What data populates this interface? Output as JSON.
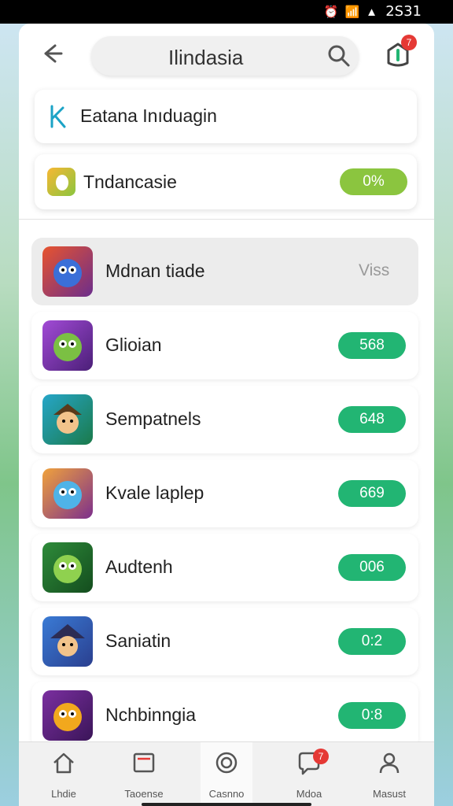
{
  "status": {
    "time": "2S31"
  },
  "header": {
    "search_text": "Ilindasia",
    "notification_badge": "7"
  },
  "cards": [
    {
      "label": "Eatana Inıduagin",
      "icon": "k-logo-icon",
      "accent": "#1ba3c6"
    },
    {
      "label": "Tndancasie",
      "value": "0%",
      "icon": "leaf-app-icon",
      "accent": "#8bc53f"
    }
  ],
  "list": [
    {
      "label": "Mdnan tiade",
      "value": "Viss",
      "icon": "game-monster-icon"
    },
    {
      "label": "Glioian",
      "value": "568",
      "icon": "game-goblin-icon"
    },
    {
      "label": "Sempatnels",
      "value": "648",
      "icon": "game-pirate-icon"
    },
    {
      "label": "Kvale laplep",
      "value": "669",
      "icon": "game-creature-icon"
    },
    {
      "label": "Audtenh",
      "value": "006",
      "icon": "game-green-monster-icon"
    },
    {
      "label": "Saniatin",
      "value": "0:2",
      "icon": "game-wizard-icon"
    },
    {
      "label": "Nchbinngia",
      "value": "0:8",
      "icon": "game-dragon-icon"
    }
  ],
  "nav": {
    "items": [
      {
        "label": "Lhdie",
        "icon": "home-icon"
      },
      {
        "label": "Taoense",
        "icon": "inbox-icon"
      },
      {
        "label": "Casnno",
        "icon": "target-icon"
      },
      {
        "label": "Mdoa",
        "icon": "chat-icon",
        "badge": "7"
      },
      {
        "label": "Masust",
        "icon": "profile-icon"
      }
    ]
  },
  "colors": {
    "pill_green": "#22b573",
    "pill_lime": "#8bc53f",
    "badge_red": "#e53935"
  }
}
